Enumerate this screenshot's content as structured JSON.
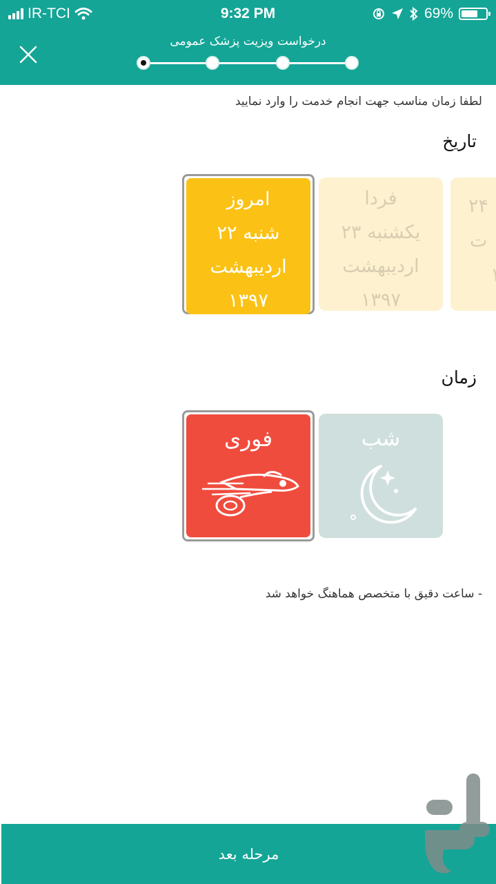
{
  "status_bar": {
    "carrier": "IR-TCI",
    "time": "9:32 PM",
    "battery_percent": "69%",
    "battery_level": 0.69
  },
  "header": {
    "title": "درخواست ویزیت پزشک عمومی",
    "steps_total": 4,
    "current_step": 1
  },
  "instruction": "لطفا زمان مناسب جهت انجام خدمت را وارد نمایید",
  "date_section": {
    "label": "تاریخ",
    "cards": [
      {
        "lines": [
          "امروز",
          "شنبه ۲۲",
          "اردیبهشت",
          "۱۳۹۷"
        ],
        "selected": true
      },
      {
        "lines": [
          "فردا",
          "یکشنبه ۲۳",
          "اردیبهشت",
          "۱۳۹۷"
        ],
        "selected": false
      },
      {
        "lines": [
          "۲۴",
          "ت",
          "",
          "۱"
        ],
        "selected": false
      }
    ]
  },
  "time_section": {
    "label": "زمان",
    "options": [
      {
        "title": "فوری",
        "icon": "rocket-icon",
        "selected": true
      },
      {
        "title": "شب",
        "icon": "moon-stars-icon",
        "selected": false
      }
    ]
  },
  "note": "- ساعت دقیق با متخصص هماهنگ خواهد شد",
  "next_button": "مرحله بعد",
  "colors": {
    "primary": "#14a596",
    "date_selected": "#fbc215",
    "date_unselected": "#fdf1d0",
    "urgent": "#f04c3e",
    "night": "#cfdfdd"
  }
}
